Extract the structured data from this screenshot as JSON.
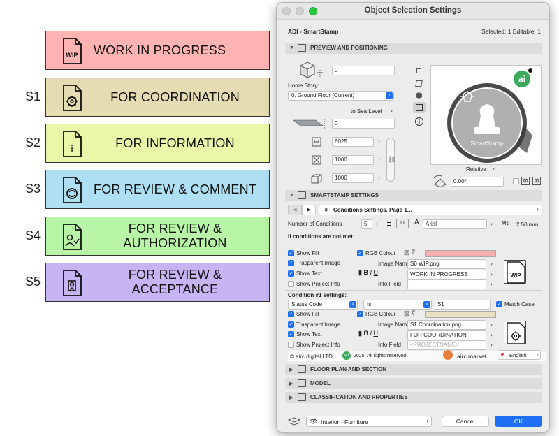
{
  "legend": [
    {
      "code": "",
      "text": "WORK IN PROGRESS",
      "icon": "wip-doc-icon",
      "icon_label": "WIP",
      "color": "#ffb3b3"
    },
    {
      "code": "S1",
      "text": "FOR COORDINATION",
      "icon": "gear-doc-icon",
      "icon_label": "",
      "color": "#e6dcb4"
    },
    {
      "code": "S2",
      "text": "FOR INFORMATION",
      "icon": "info-doc-icon",
      "icon_label": "i",
      "color": "#eaf7a8"
    },
    {
      "code": "S3",
      "text": "FOR REVIEW & COMMENT",
      "icon": "refresh-doc-icon",
      "icon_label": "",
      "color": "#aedff3"
    },
    {
      "code": "S4",
      "text": "FOR REVIEW & AUTHORIZATION",
      "icon": "person-check-doc-icon",
      "icon_label": "",
      "color": "#b8f5a6"
    },
    {
      "code": "S5",
      "text": "FOR REVIEW & ACCEPTANCE",
      "icon": "badge-doc-icon",
      "icon_label": "",
      "color": "#c6b4f3"
    }
  ],
  "dialog": {
    "title": "Object Selection Settings",
    "object_name": "ADI - SmartStamp",
    "selection_status": "Selected: 1 Editable: 1",
    "preview": {
      "header": "PREVIEW AND POSITIONING",
      "elevation_value": "0",
      "home_story_label": "Home Story:",
      "home_story_value": "0. Ground Floor (Current)",
      "to_sea_level_label": "to Sea Level",
      "sea_level_value": "0",
      "width_value": "6025",
      "depth_value": "1000",
      "height_value": "1000",
      "relative_label": "Relative",
      "angle_value": "0.00°",
      "stamp_label": "SmartStamp",
      "logo_text": "ai"
    },
    "smartstamp": {
      "header": "SMARTSTAMP SETTINGS",
      "page_label": "Conditions Settings. Page 1...",
      "num_conditions_label": "Number of Conditions",
      "num_conditions_value": "5",
      "font_value": "Arial",
      "font_size_value": "2.50 mm",
      "not_met_label": "If conditions are not met:",
      "show_fill": "Show Fill",
      "rgb_colour": "RGB Colour",
      "fill_color_1": "#f7b0b0",
      "transparent_image": "Trasparent Image",
      "image_name_label": "Image Name",
      "image_name_1": "S0 WIP.png",
      "show_text": "Show Text",
      "text_1": "WORK IN PROGRESS",
      "show_project_info": "Show Project Info",
      "info_field_label": "Info Field",
      "info_field_1": "",
      "wip_icon_label": "WIP",
      "condition1_label": "Condition #1 settings:",
      "cond_status_code": "Status Code",
      "cond_operator": "Is",
      "cond_value": "S1",
      "match_case": "Match Case",
      "fill_color_2": "#e8e0c2",
      "image_name_2": "S1 Coordination.png",
      "text_2": "FOR COORDINATION",
      "info_field_2_placeholder": "<PROJECTNAME>",
      "copyright": "© airc.digital LTD",
      "rights": "2025. All rights reserved.",
      "market": "airc.market",
      "language": "English"
    },
    "sections": {
      "floor_plan": "FLOOR PLAN AND SECTION",
      "model": "MODEL",
      "classification": "CLASSIFICATION AND PROPERTIES"
    },
    "footer": {
      "view_value": "Interior - Furniture",
      "cancel": "Cancel",
      "ok": "OK"
    }
  }
}
